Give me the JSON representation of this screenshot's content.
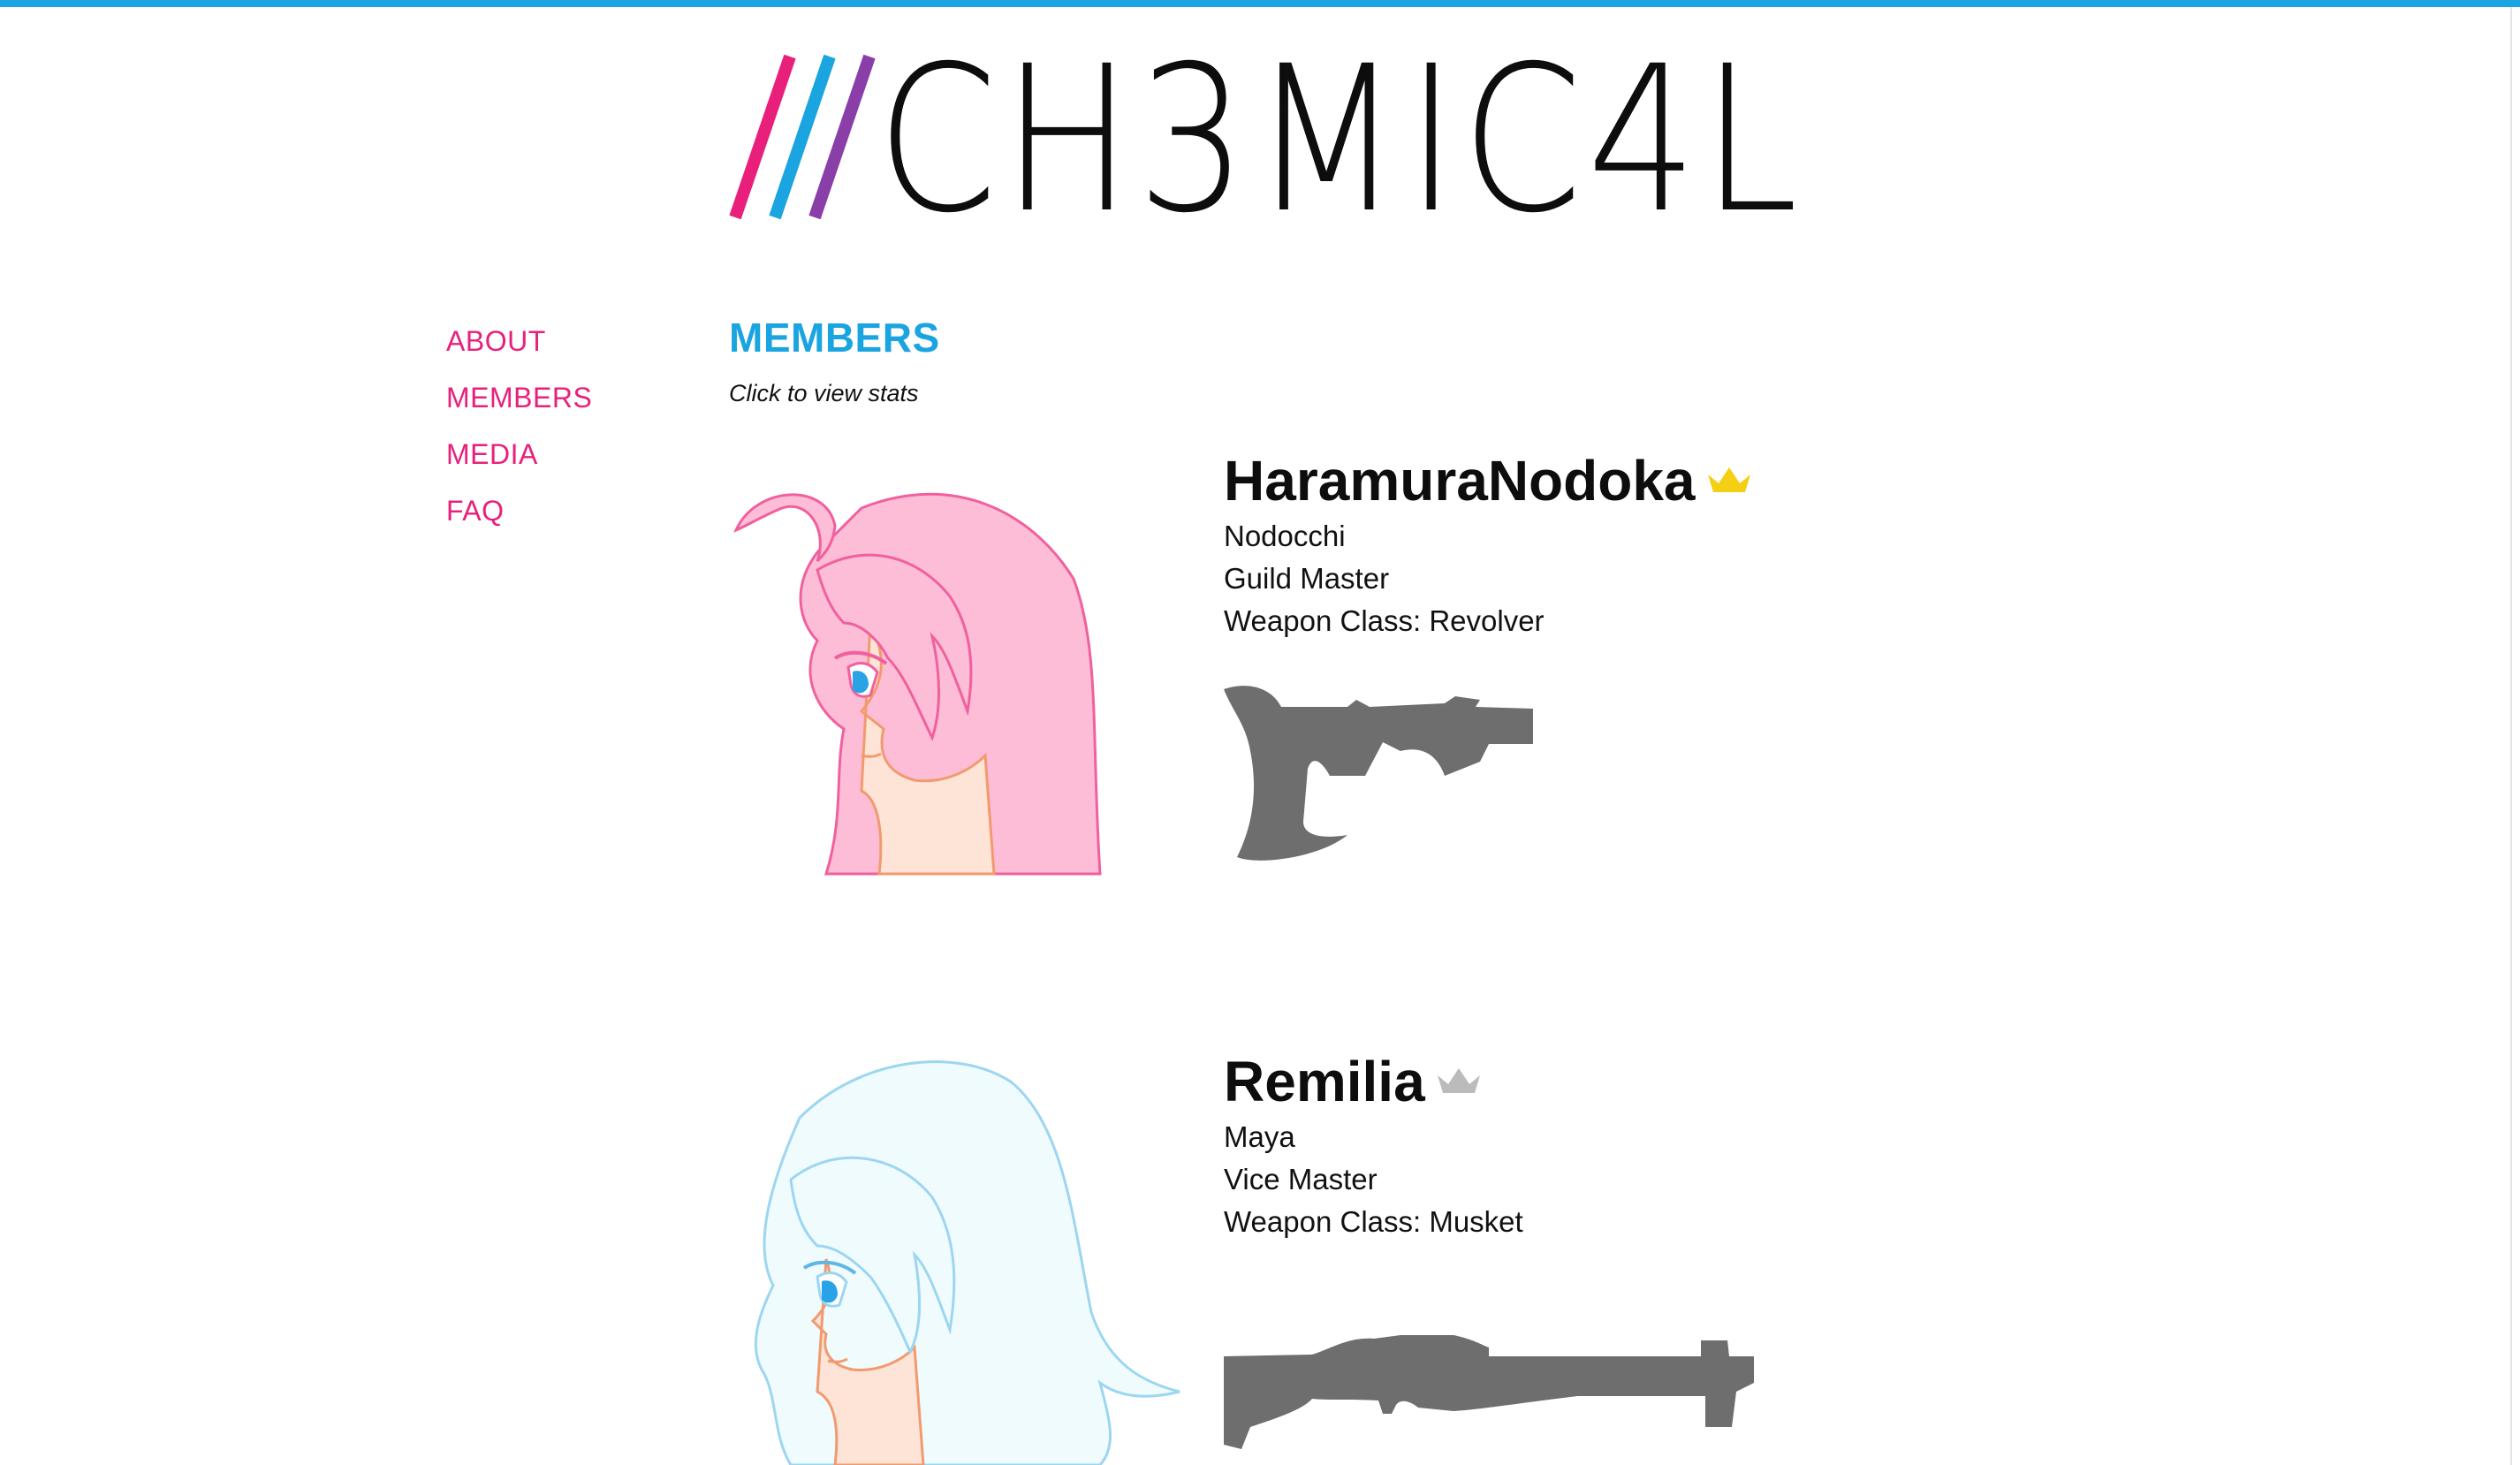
{
  "logo": {
    "text": "CH3MIC4L",
    "slash_colors": [
      "#e9207b",
      "#1aa4e0",
      "#8a3fa8"
    ]
  },
  "nav": {
    "items": [
      {
        "label": "ABOUT"
      },
      {
        "label": "MEMBERS"
      },
      {
        "label": "MEDIA"
      },
      {
        "label": "FAQ"
      }
    ]
  },
  "section": {
    "title": "MEMBERS",
    "hint": "Click to view stats"
  },
  "members": [
    {
      "name": "HaramuraNodoka",
      "crown_icon": "gold-crown-icon",
      "nickname": "Nodocchi",
      "role": "Guild Master",
      "weapon_class": "Weapon Class: Revolver",
      "hair_color": "#fdbdd7",
      "line_color": "#f0609e"
    },
    {
      "name": "Remilia",
      "crown_icon": "silver-crown-icon",
      "nickname": "Maya",
      "role": "Vice Master",
      "weapon_class": "Weapon Class: Musket",
      "hair_color": "#f0fbfe",
      "line_color": "#9cd6f0"
    }
  ],
  "colors": {
    "accent_blue": "#1aa4e0",
    "accent_pink": "#e9207b",
    "crown_gold": "#f5cf13",
    "crown_silver": "#bbbbbb",
    "weapon_gray": "#6e6e6e"
  }
}
